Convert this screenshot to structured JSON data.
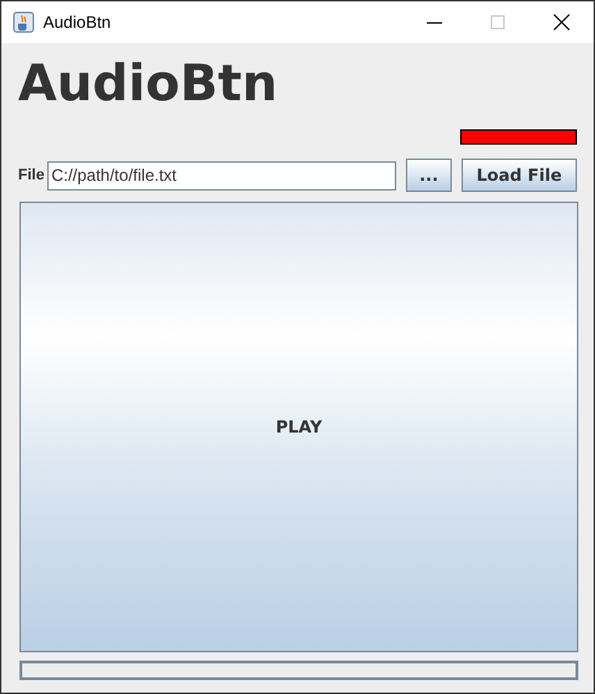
{
  "window": {
    "title": "AudioBtn"
  },
  "heading": "AudioBtn",
  "indicator": {
    "color": "#ff0000"
  },
  "file_label": "File",
  "file_field": {
    "value": "C://path/to/file.txt"
  },
  "browse_button": "...",
  "load_button": "Load File",
  "play_button": "PLAY",
  "progress": {
    "level": 0
  }
}
